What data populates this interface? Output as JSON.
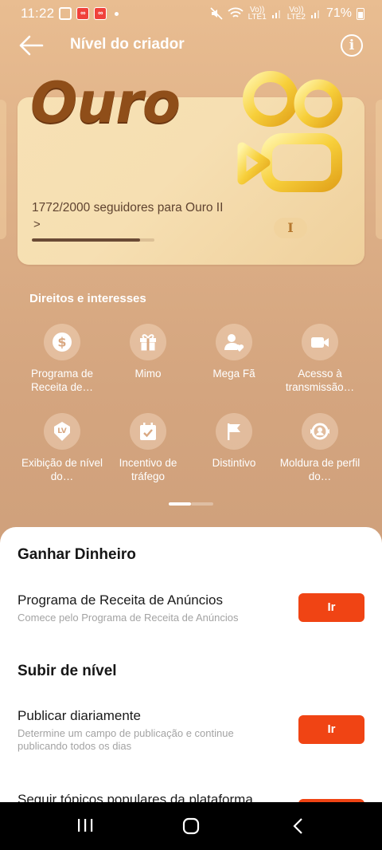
{
  "status_bar": {
    "time": "11:22",
    "battery": "71%",
    "lte1": "LTE1",
    "lte2": "LTE2",
    "volte": "Vo))"
  },
  "header": {
    "title": "Nível do criador",
    "info_glyph": "i"
  },
  "level_card": {
    "level_name": "Ouro",
    "progress_text": "1772/2000 seguidores para Ouro II",
    "progress_value": 0.886,
    "chevron": ">",
    "roman_badge": "I",
    "icon": "kwai-camera-logo"
  },
  "rights": {
    "title": "Direitos e interesses",
    "items": [
      {
        "label": "Programa de Receita de…",
        "icon": "dollar-icon"
      },
      {
        "label": "Mimo",
        "icon": "gift-icon"
      },
      {
        "label": "Mega Fã",
        "icon": "fan-heart-icon"
      },
      {
        "label": "Acesso à transmissão…",
        "icon": "video-camera-icon"
      },
      {
        "label": "Exibição de nível do…",
        "icon": "lv-badge-icon"
      },
      {
        "label": "Incentivo de tráfego",
        "icon": "calendar-check-icon"
      },
      {
        "label": "Distintivo",
        "icon": "flag-icon"
      },
      {
        "label": "Moldura de perfil do…",
        "icon": "profile-frame-icon"
      }
    ],
    "page_index": 1,
    "page_count": 2
  },
  "sheet": {
    "earn_title": "Ganhar Dinheiro",
    "earn_task": {
      "title": "Programa de Receita de Anúncios",
      "desc": "Comece pelo Programa de Receita de Anúncios",
      "button": "Ir"
    },
    "level_title": "Subir de nível",
    "level_task": {
      "title": "Publicar diariamente",
      "desc": "Determine um campo de publicação e continue publicando todos os dias",
      "button": "Ir"
    },
    "next_task_title": "Seguir tópicos populares da plataforma"
  },
  "colors": {
    "accent": "#f04414",
    "gold_text": "#8f4e19",
    "background": "#dcae86"
  }
}
